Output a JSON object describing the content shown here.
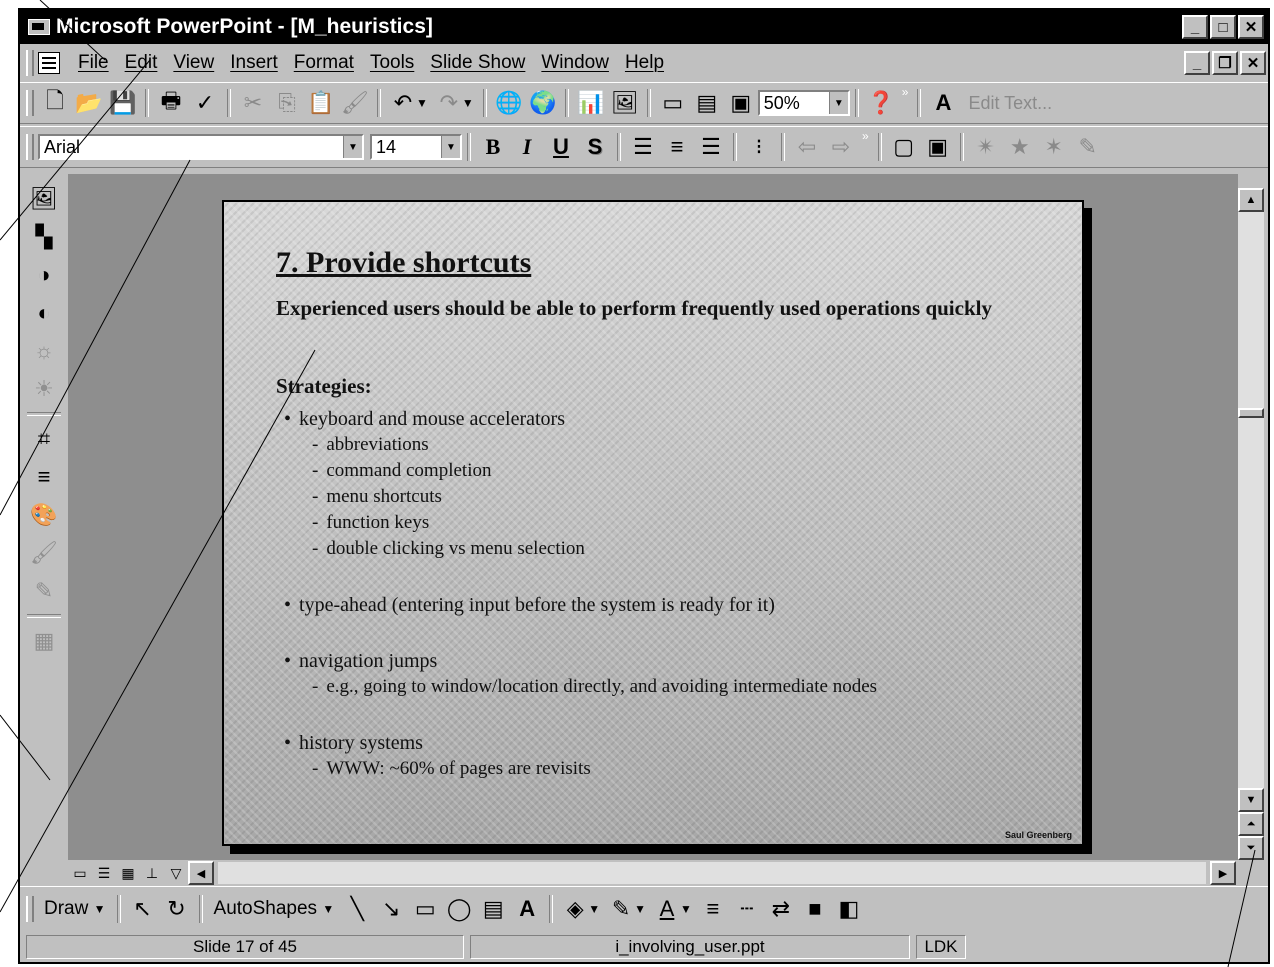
{
  "window": {
    "title": "Microsoft PowerPoint - [M_heuristics]"
  },
  "menus": [
    "File",
    "Edit",
    "View",
    "Insert",
    "Format",
    "Tools",
    "Slide Show",
    "Window",
    "Help"
  ],
  "standard_toolbar": {
    "zoom": "50%",
    "edit_text": "Edit Text..."
  },
  "formatting_toolbar": {
    "font": "Arial",
    "size": "14",
    "bold": "B",
    "italic": "I",
    "underline": "U",
    "shadow": "S"
  },
  "slide": {
    "title": "7. Provide shortcuts",
    "subtitle": "Experienced users should be able to perform frequently used operations quickly",
    "strategies_label": "Strategies:",
    "bullets": [
      {
        "text": "keyboard and mouse accelerators",
        "subs": [
          "abbreviations",
          "command completion",
          "menu shortcuts",
          "function keys",
          "double clicking vs menu selection"
        ]
      },
      {
        "text": "type-ahead (entering input before the system is ready for it)",
        "subs": []
      },
      {
        "text": "navigation jumps",
        "subs": [
          "e.g., going to window/location directly, and avoiding intermediate nodes"
        ]
      },
      {
        "text": "history systems",
        "subs": [
          "WWW: ~60% of pages are revisits"
        ]
      }
    ],
    "footer": "Saul Greenberg"
  },
  "drawing_toolbar": {
    "draw": "Draw",
    "autoshapes": "AutoShapes"
  },
  "statusbar": {
    "slide_info": "Slide 17 of 45",
    "filename": "i_involving_user.ppt",
    "spell": "LDK"
  }
}
